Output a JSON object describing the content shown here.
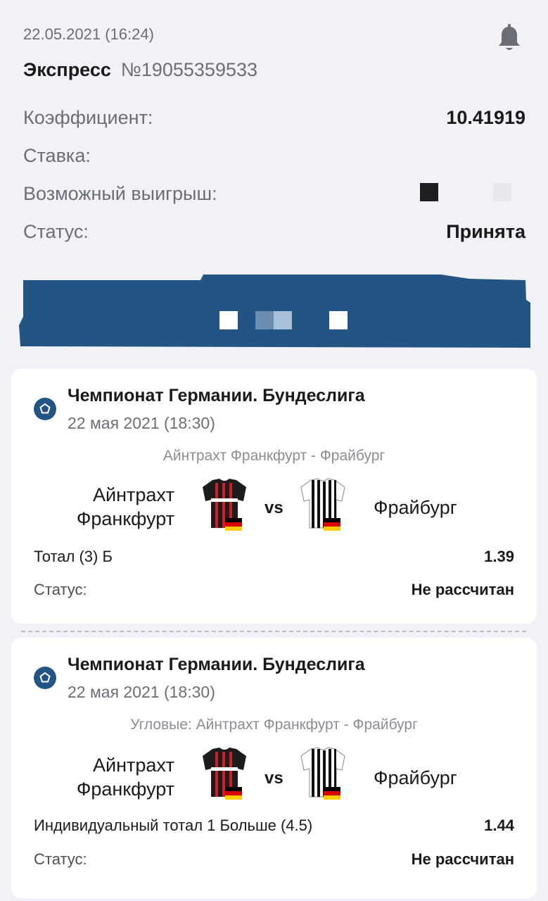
{
  "header": {
    "datetime": "22.05.2021 (16:24)",
    "bet_kind": "Экспресс",
    "bet_number": "№19055359533",
    "rows": [
      {
        "label": "Коэффициент:",
        "value": "10.41919"
      },
      {
        "label": "Ставка:",
        "value": ""
      },
      {
        "label": "Возможный выигрыш:",
        "value": ""
      },
      {
        "label": "Статус:",
        "value": "Принята"
      }
    ],
    "icon": "bell-icon"
  },
  "colors": {
    "banner": "#235584",
    "sport_icon": "#235584"
  },
  "events": [
    {
      "league": "Чемпионат Германии. Бундеслига",
      "date": "22 мая 2021 (18:30)",
      "match": "Айнтрахт Франкфурт - Фрайбург",
      "home": "Айнтрахт Франкфурт",
      "vs": "vs",
      "away": "Фрайбург",
      "market": "Тотал (3) Б",
      "odds": "1.39",
      "status_label": "Статус:",
      "status": "Не рассчитан"
    },
    {
      "league": "Чемпионат Германии. Бундеслига",
      "date": "22 мая 2021 (18:30)",
      "match": "Угловые: Айнтрахт Франкфурт - Фрайбург",
      "home": "Айнтрахт Франкфурт",
      "vs": "vs",
      "away": "Фрайбург",
      "market": "Индивидуальный тотал 1 Больше (4.5)",
      "odds": "1.44",
      "status_label": "Статус:",
      "status": "Не рассчитан"
    }
  ]
}
